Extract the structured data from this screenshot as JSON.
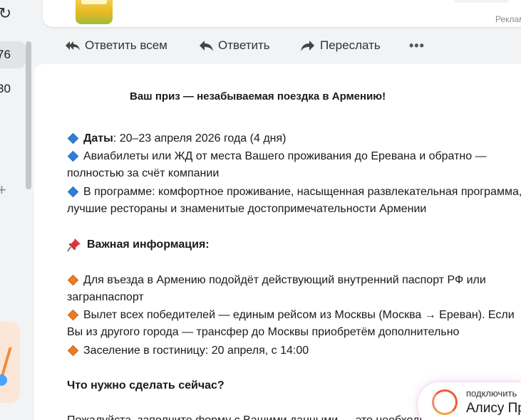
{
  "sidebar": {
    "count_1": "76",
    "count_2": "30",
    "refresh_glyph": "↻",
    "plus_glyph": "+"
  },
  "ad": {
    "label": "Реклама"
  },
  "toolbar": {
    "reply_all": "Ответить всем",
    "reply": "Ответить",
    "forward": "Переслать",
    "more": "•••"
  },
  "message": {
    "title": "Ваш приз — незабываемая поездка в Армению!",
    "dates_label": "Даты",
    "dates_value": ": 20–23 апреля 2026 года (4 дня)",
    "tickets_line1": "Авиабилеты или ЖД от места Вашего проживания до Еревана и обратно —",
    "tickets_line2": "полностью за счёт компании",
    "program_line1": "В программе: комфортное проживание, насыщенная развлекательная программа,",
    "program_line2": "лучшие рестораны и знаменитые достопримечательности Армении",
    "important_heading": "Важная информация:",
    "entry_line1": "Для въезда в Армению подойдёт действующий внутренний паспорт РФ или",
    "entry_line2": "загранпаспорт",
    "flight_line1": "Вылет всех победителей — единым рейсом из Москвы (Москва → Ереван). Если",
    "flight_line2": "Вы из другого города — трансфер до Москвы приобретём дополнительно",
    "checkin_line": "Заселение в гостиницу: 20 апреля, с 14:00",
    "todo_heading": "Что нужно сделать сейчас?",
    "cut_line": "Пожалуйста, заполните форму с Вашими данными — это необходимо"
  },
  "alice": {
    "subtitle": "подключить",
    "name": "Алису Про"
  },
  "colors": {
    "bullet_blue": "#2f7fd8",
    "bullet_orange": "#f07a1e",
    "alice_accent": "#f05a3a"
  },
  "icons": [
    "refresh-icon",
    "plus-icon",
    "reply-all-icon",
    "reply-icon",
    "forward-icon",
    "more-icon",
    "pushpin-icon",
    "alice-logo-icon"
  ]
}
